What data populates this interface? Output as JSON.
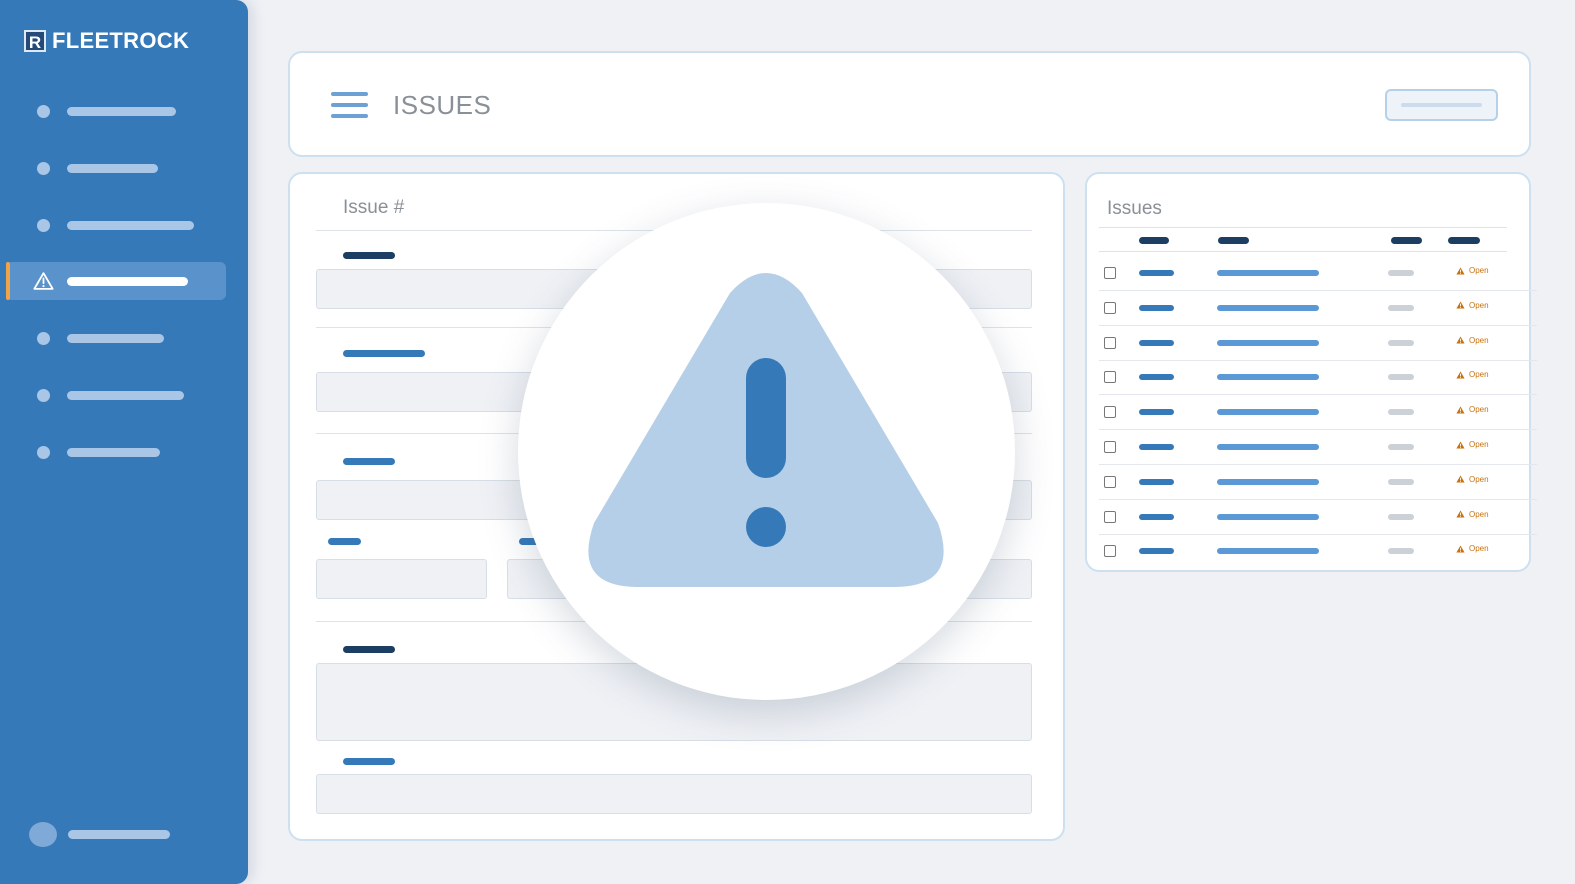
{
  "brand": {
    "name": "FLEETROCK",
    "mark": "R"
  },
  "header": {
    "title": "ISSUES"
  },
  "form": {
    "title": "Issue #"
  },
  "list": {
    "title": "Issues",
    "rows": [
      {
        "status": "Open"
      },
      {
        "status": "Open"
      },
      {
        "status": "Open"
      },
      {
        "status": "Open"
      },
      {
        "status": "Open"
      },
      {
        "status": "Open"
      },
      {
        "status": "Open"
      },
      {
        "status": "Open"
      },
      {
        "status": "Open"
      }
    ]
  },
  "icons": {
    "menu": "hamburger-menu-icon",
    "alert": "warning-triangle-icon"
  },
  "colors": {
    "sidebar": "#3579b9",
    "accent": "#f0a44a",
    "status_open": "#c7720f",
    "alert_fill": "#b6cfe8",
    "alert_mark": "#3579b9"
  }
}
